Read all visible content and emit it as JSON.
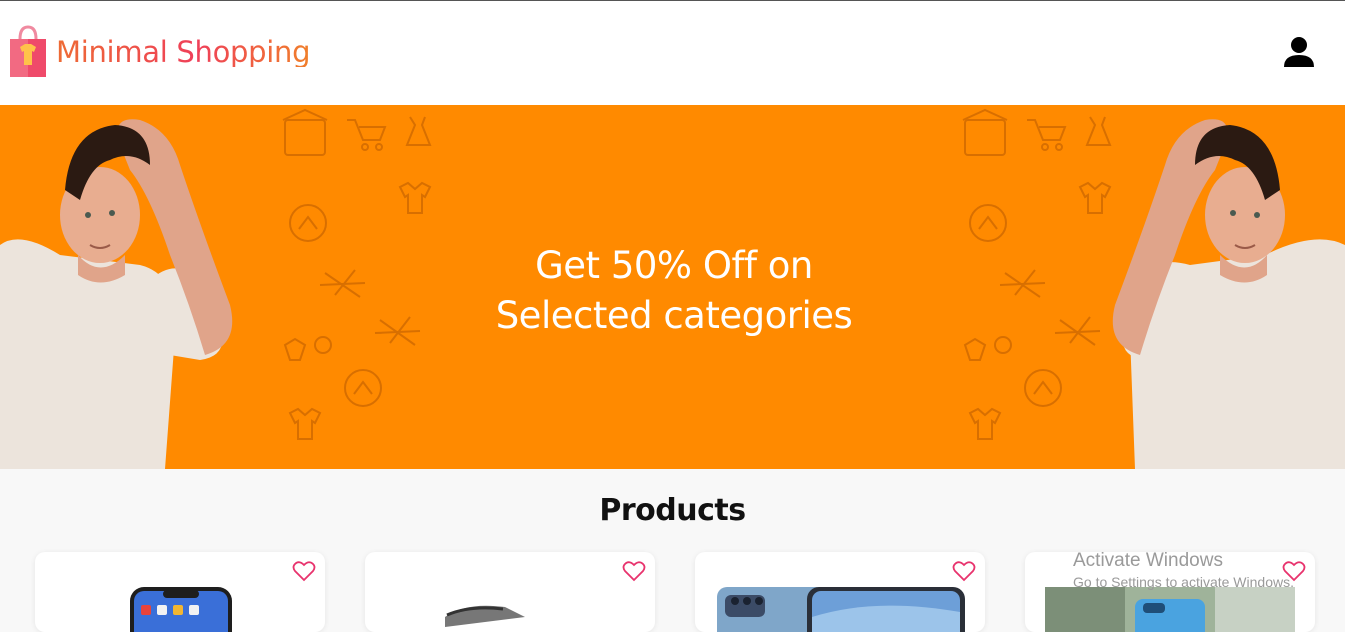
{
  "header": {
    "brand": "Minimal Shopping",
    "logo_icon": "shopping-bag-icon",
    "user_icon": "user-icon"
  },
  "hero": {
    "headline_line1": "Get 50% Off on",
    "headline_line2": "Selected categories",
    "background_color": "#ff8a00"
  },
  "products": {
    "title": "Products",
    "items": [
      {
        "product": "smartphone",
        "icon": "heart-icon"
      },
      {
        "product": "device",
        "icon": "heart-icon"
      },
      {
        "product": "smartphone",
        "icon": "heart-icon"
      },
      {
        "product": "smartphone",
        "icon": "heart-icon"
      }
    ]
  },
  "watermark": {
    "line1": "Activate Windows",
    "line2": "Go to Settings to activate Windows."
  },
  "colors": {
    "accent": "#ff8a00",
    "heart": "#e8336d",
    "brand_start": "#ee6b34",
    "brand_end": "#ef3f59"
  }
}
